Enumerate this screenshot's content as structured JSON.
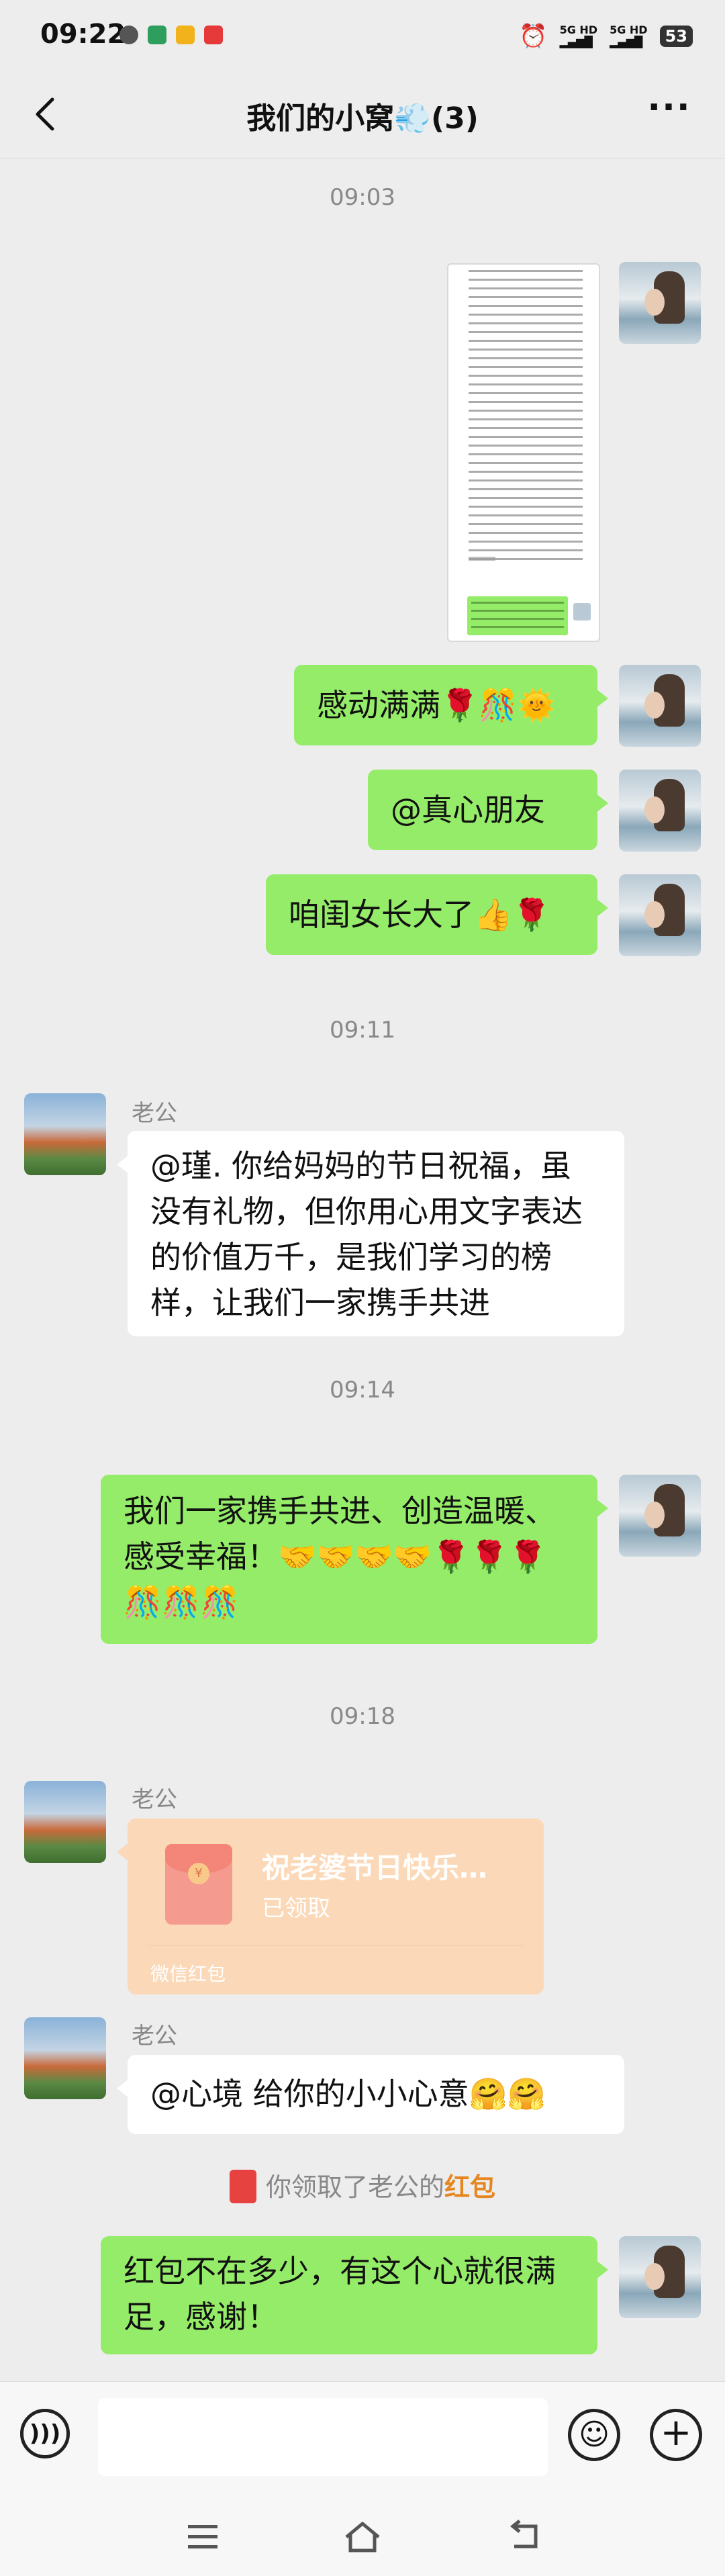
{
  "status_bar": {
    "time": "09:22",
    "net1": "5G HD",
    "net2": "5G HD",
    "battery": "53"
  },
  "nav": {
    "title": "我们的小窝💨(3)",
    "back_icon": "chevron-left-icon",
    "more_icon": "more-dots-icon"
  },
  "timestamps": [
    "09:03",
    "09:11",
    "09:14",
    "09:18"
  ],
  "messages": {
    "m1": "感动满满🌹🎊🌞",
    "m2": "@真心朋友",
    "m3": "咱闺女长大了👍🌹",
    "m4_sender": "老公",
    "m4": "@瑾. 你给妈妈的节日祝福，虽没有礼物，但你用心用文字表达的价值万千，是我们学习的榜样，让我们一家携手共进",
    "m5": "我们一家携手共进、创造温暖、感受幸福！🤝🤝🤝🤝🌹🌹🌹🎊🎊🎊",
    "m6_sender": "老公",
    "m8_sender": "老公",
    "m8": "@心境  给你的小小心意🤗🤗",
    "m9": "红包不在多少，有这个心就很满足，感谢！"
  },
  "red_packet": {
    "title": "祝老婆节日快乐…",
    "status": "已领取",
    "footer": "微信红包"
  },
  "notice": {
    "text": "你领取了老公的",
    "link": "红包"
  },
  "input_bar": {
    "voice_icon": "voice-icon",
    "emoji_icon": "emoji-icon",
    "plus_icon": "plus-icon"
  }
}
